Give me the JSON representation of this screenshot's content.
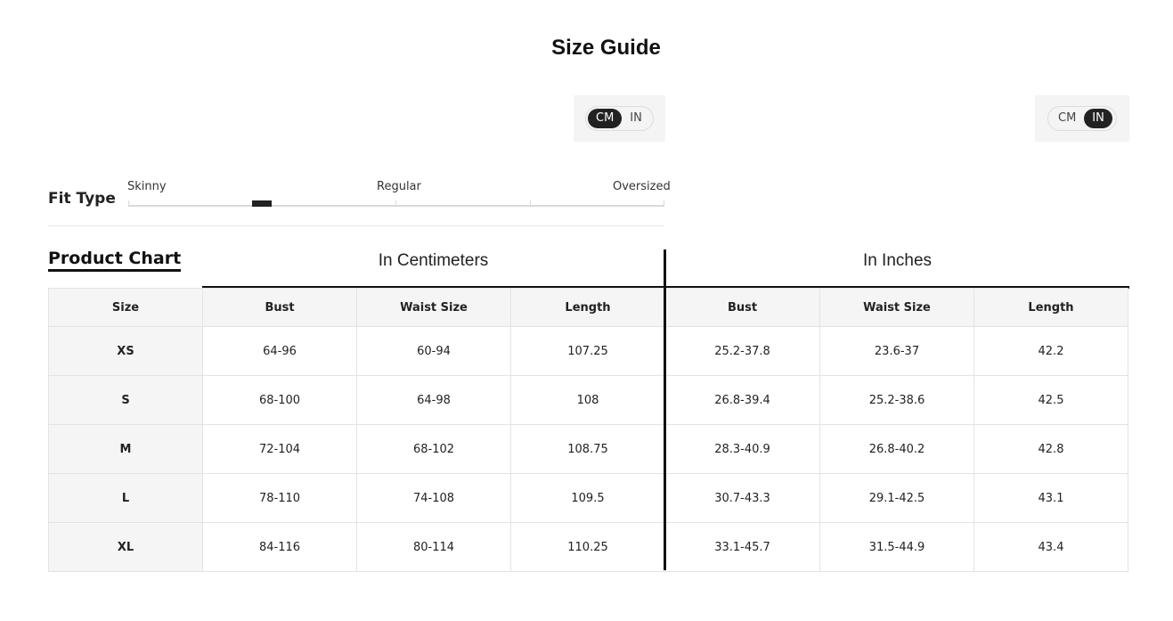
{
  "page": {
    "title": "Size Guide"
  },
  "unit_toggle_left": {
    "options": [
      "CM",
      "IN"
    ],
    "selected": "CM"
  },
  "unit_toggle_right": {
    "options": [
      "CM",
      "IN"
    ],
    "selected": "IN"
  },
  "fit_type": {
    "label": "Fit Type",
    "scale_labels": [
      "Skinny",
      "Regular",
      "Oversized"
    ]
  },
  "product_chart": {
    "title": "Product Chart",
    "groups": [
      "In Centimeters",
      "In Inches"
    ],
    "headers": [
      "Size",
      "Bust",
      "Waist Size",
      "Length",
      "Bust",
      "Waist Size",
      "Length"
    ],
    "rows": [
      [
        "XS",
        "64-96",
        "60-94",
        "107.25",
        "25.2-37.8",
        "23.6-37",
        "42.2"
      ],
      [
        "S",
        "68-100",
        "64-98",
        "108",
        "26.8-39.4",
        "25.2-38.6",
        "42.5"
      ],
      [
        "M",
        "72-104",
        "68-102",
        "108.75",
        "28.3-40.9",
        "26.8-40.2",
        "42.8"
      ],
      [
        "L",
        "78-110",
        "74-108",
        "109.5",
        "30.7-43.3",
        "29.1-42.5",
        "43.1"
      ],
      [
        "XL",
        "84-116",
        "80-114",
        "110.25",
        "33.1-45.7",
        "31.5-44.9",
        "43.4"
      ]
    ]
  },
  "colors": {
    "accent": "#222222",
    "header_bg": "#f5f5f5",
    "border": "#e3e3e3"
  }
}
